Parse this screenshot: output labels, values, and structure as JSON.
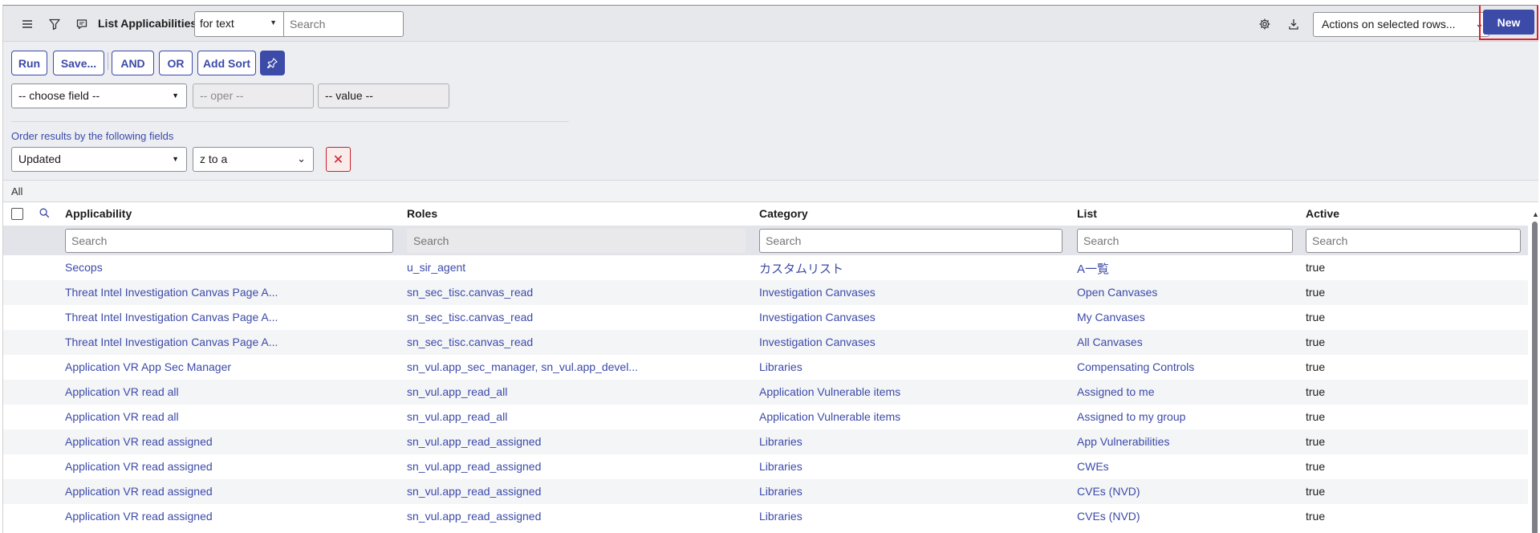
{
  "header": {
    "menu_icon": "hamburger-menu-icon",
    "filter_icon": "funnel-filter-icon",
    "context_icon": "chat-context-icon",
    "title": "List Applicabilities",
    "search_field_select": "for text",
    "search_placeholder": "Search",
    "settings_icon": "gear-icon",
    "download_icon": "download-icon",
    "actions_select": "Actions on selected rows...",
    "new_label": "New",
    "highlight_color": "#e0202a"
  },
  "filter": {
    "run_label": "Run",
    "save_label": "Save...",
    "and_label": "AND",
    "or_label": "OR",
    "add_sort_label": "Add Sort",
    "pin_icon": "pin-icon",
    "choose_field": "-- choose field --",
    "oper": "-- oper --",
    "value": "-- value --",
    "order_label": "Order results by the following fields",
    "order_field": "Updated",
    "order_direction": "z to a",
    "remove_icon": "close-icon"
  },
  "breadcrumb": {
    "label": "All"
  },
  "table": {
    "columns": [
      "Applicability",
      "Roles",
      "Category",
      "List",
      "Active"
    ],
    "search_placeholder": "Search",
    "rows": [
      {
        "applicability": "Secops",
        "roles": "u_sir_agent",
        "category": "カスタムリスト",
        "list": "A一覧",
        "active": "true"
      },
      {
        "applicability": "Threat Intel Investigation Canvas Page A...",
        "roles": "sn_sec_tisc.canvas_read",
        "category": "Investigation Canvases",
        "list": "Open Canvases",
        "active": "true"
      },
      {
        "applicability": "Threat Intel Investigation Canvas Page A...",
        "roles": "sn_sec_tisc.canvas_read",
        "category": "Investigation Canvases",
        "list": "My Canvases",
        "active": "true"
      },
      {
        "applicability": "Threat Intel Investigation Canvas Page A...",
        "roles": "sn_sec_tisc.canvas_read",
        "category": "Investigation Canvases",
        "list": "All Canvases",
        "active": "true"
      },
      {
        "applicability": "Application VR App Sec Manager",
        "roles": "sn_vul.app_sec_manager, sn_vul.app_devel...",
        "category": "Libraries",
        "list": "Compensating Controls",
        "active": "true"
      },
      {
        "applicability": "Application VR read all",
        "roles": "sn_vul.app_read_all",
        "category": "Application Vulnerable items",
        "list": "Assigned to me",
        "active": "true"
      },
      {
        "applicability": "Application VR read all",
        "roles": "sn_vul.app_read_all",
        "category": "Application Vulnerable items",
        "list": "Assigned to my group",
        "active": "true"
      },
      {
        "applicability": "Application VR read assigned",
        "roles": "sn_vul.app_read_assigned",
        "category": "Libraries",
        "list": "App Vulnerabilities",
        "active": "true"
      },
      {
        "applicability": "Application VR read assigned",
        "roles": "sn_vul.app_read_assigned",
        "category": "Libraries",
        "list": "CWEs",
        "active": "true"
      },
      {
        "applicability": "Application VR read assigned",
        "roles": "sn_vul.app_read_assigned",
        "category": "Libraries",
        "list": "CVEs (NVD)",
        "active": "true"
      },
      {
        "applicability": "Application VR read assigned",
        "roles": "sn_vul.app_read_assigned",
        "category": "Libraries",
        "list": "CVEs (NVD)",
        "active": "true"
      }
    ]
  },
  "colors": {
    "primary": "#3c4aa8",
    "danger": "#c9202a"
  }
}
